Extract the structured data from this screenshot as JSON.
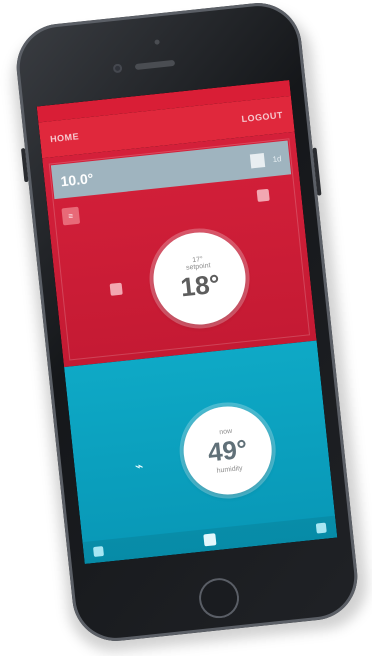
{
  "header": {
    "left_label": "HOME",
    "right_label": "LOGOUT"
  },
  "info_bar": {
    "temperature": "10.0°",
    "secondary": "1d"
  },
  "hot_zone": {
    "dial": {
      "line1": "17°",
      "line2": "setpoint",
      "value": "18°"
    }
  },
  "cold_zone": {
    "dial": {
      "line1": "now",
      "value": "49°",
      "line2": "humidity"
    }
  },
  "colors": {
    "hot": "#d4203a",
    "cold": "#0ea9c6",
    "header": "#e0283c"
  }
}
